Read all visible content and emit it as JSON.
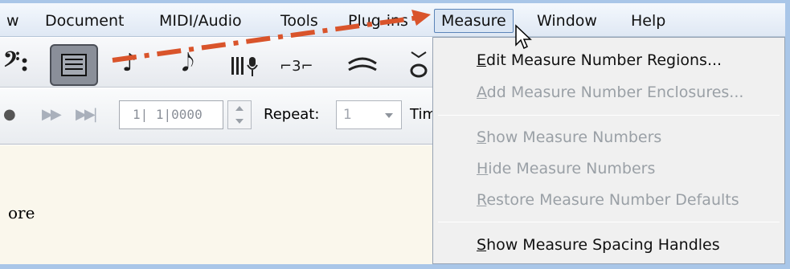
{
  "menubar": {
    "items": [
      {
        "label": "w"
      },
      {
        "label": "Document"
      },
      {
        "label": "MIDI/Audio"
      },
      {
        "label": "Tools"
      },
      {
        "label": "Plug-ins"
      },
      {
        "label": "Measure"
      },
      {
        "label": "Window"
      },
      {
        "label": "Help"
      }
    ]
  },
  "toolbar": {
    "icons": [
      "bass-clef-icon",
      "measure-tool-icon",
      "note-icon",
      "eighth-note-icon",
      "staff-mic-icon",
      "tuplet-icon",
      "slur-icon",
      "articulation-icon"
    ],
    "bass_clef_glyph": "𝄢:",
    "note_glyph": "♪",
    "eighth_glyph": "𝅘𝅥𝅮",
    "tuplet_glyph": "⌐3⌐",
    "slur_glyph": "⋐",
    "art_glyph": "ǒ"
  },
  "transport": {
    "counter_value": "1| 1|0000",
    "repeat_label": "Repeat:",
    "repeat_value": "1",
    "tim_label": "Tim"
  },
  "score": {
    "text": "ore"
  },
  "dropdown": {
    "items": [
      {
        "label": "Edit Measure Number Regions...",
        "mnemonic": "E",
        "enabled": true
      },
      {
        "label": "Add Measure Number Enclosures...",
        "mnemonic": "A",
        "enabled": false
      },
      {
        "label": "Show Measure Numbers",
        "mnemonic": "S",
        "enabled": false
      },
      {
        "label": "Hide Measure Numbers",
        "mnemonic": "H",
        "enabled": false
      },
      {
        "label": "Restore Measure Number Defaults",
        "mnemonic": "R",
        "enabled": false
      },
      {
        "label": "Show Measure Spacing Handles",
        "mnemonic": "S",
        "enabled": true
      }
    ]
  },
  "colors": {
    "annotation_arrow": "#d9542b",
    "frame": "#a9c6e8",
    "disabled_text": "#9aa0a6"
  }
}
